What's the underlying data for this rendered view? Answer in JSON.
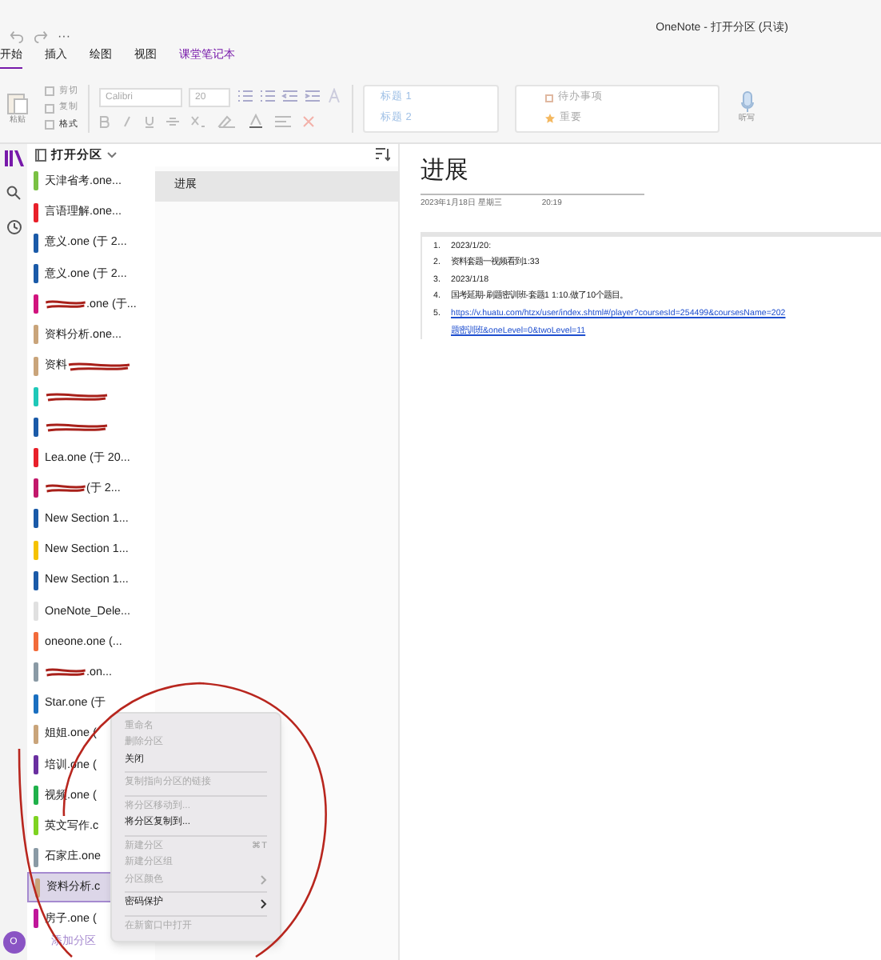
{
  "window": {
    "title": "OneNote - 打开分区 (只读)",
    "more": "···"
  },
  "ribbon": {
    "tabs": [
      {
        "label": "开始",
        "selected": true
      },
      {
        "label": "插入",
        "selected": false
      },
      {
        "label": "绘图",
        "selected": false
      },
      {
        "label": "视图",
        "selected": false
      },
      {
        "label": "课堂笔记本",
        "selected": false,
        "kind": "accent"
      }
    ],
    "paste": "粘贴",
    "clipboard": [
      "剪切",
      "复制",
      "格式"
    ],
    "font": "Calibri",
    "size": "20",
    "styles": [
      "标题 1",
      "标题 2"
    ],
    "tags": [
      "待办事项",
      "重要"
    ],
    "dictate": "听写"
  },
  "sidebar": {
    "header": "打开分区",
    "add_label": "添加分区",
    "avatar": "O"
  },
  "sections": [
    {
      "label": "天津省考.one...",
      "color": "#7ac143",
      "selected": false,
      "scribbled": false
    },
    {
      "label": "言语理解.one...",
      "color": "#e8202a",
      "selected": false,
      "scribbled": false
    },
    {
      "label": "意义.one (于 2...",
      "color": "#1a5aa8",
      "selected": false,
      "scribbled": false
    },
    {
      "label": "意义.one (于 2...",
      "color": "#1a5aa8",
      "selected": false,
      "scribbled": false
    },
    {
      "label": ".one (于...",
      "color": "#d1137e",
      "selected": false,
      "scribbled": true
    },
    {
      "label": "资料分析.one...",
      "color": "#c9a47a",
      "selected": false,
      "scribbled": false
    },
    {
      "label": "资料",
      "color": "#c9a47a",
      "selected": false,
      "scribbled": true
    },
    {
      "color": "#1ec8b8",
      "selected": false,
      "scribbled": true
    },
    {
      "color": "#1a5aa8",
      "selected": false,
      "scribbled": true
    },
    {
      "label": "Lea.one (于 20...",
      "color": "#e8202a",
      "selected": false,
      "scribbled": false
    },
    {
      "label": "(于 2...",
      "color": "#c2186b",
      "selected": false,
      "scribbled": true
    },
    {
      "label": "New Section 1...",
      "color": "#1a5aa8",
      "selected": false,
      "scribbled": false
    },
    {
      "label": "New Section 1...",
      "color": "#f5c200",
      "selected": false,
      "scribbled": false
    },
    {
      "label": "New Section 1...",
      "color": "#1a5aa8",
      "selected": false,
      "scribbled": false
    },
    {
      "label": "OneNote_Dele...",
      "color": "#e0e0e0",
      "selected": false,
      "scribbled": false
    },
    {
      "label": "oneone.one (...",
      "color": "#f26b3a",
      "selected": false,
      "scribbled": false
    },
    {
      "label": ".on...",
      "color": "#8a9aa5",
      "selected": false,
      "scribbled": true
    },
    {
      "label": "Star.one (于",
      "color": "#1a6fc0",
      "selected": false,
      "scribbled": false
    },
    {
      "label": "姐姐.one (",
      "color": "#c9a47a",
      "selected": false,
      "scribbled": false
    },
    {
      "label": "培训.one (",
      "color": "#6a2fa0",
      "selected": false,
      "scribbled": false
    },
    {
      "label": "视频.one (",
      "color": "#1fb14a",
      "selected": false,
      "scribbled": false
    },
    {
      "label": "英文写作.c",
      "color": "#7ed321",
      "selected": false,
      "scribbled": false
    },
    {
      "label": "石家庄.one",
      "color": "#8a9aa5",
      "selected": false,
      "scribbled": false
    },
    {
      "label": "资料分析.c",
      "color": "#c9a47a",
      "selected": true,
      "scribbled": false
    },
    {
      "label": "房子.one (",
      "color": "#c0169a",
      "selected": false,
      "scribbled": false
    }
  ],
  "pages": [
    {
      "label": "进展",
      "selected": true
    }
  ],
  "page": {
    "title": "进展",
    "date": "2023年1月18日 星期三",
    "time": "20:19",
    "items": [
      {
        "number": "1.",
        "text": "2023/1/20:",
        "kind": "text"
      },
      {
        "number": "2.",
        "text": "资料套题一视频看到1:33",
        "kind": "text"
      },
      {
        "number": "3.",
        "text": "2023/1/18",
        "kind": "text"
      },
      {
        "number": "4.",
        "text": "国考延期-刷题密训班-套题1 1:10.做了10个题目。",
        "kind": "text"
      },
      {
        "number": "5.",
        "text": "https://v.huatu.com/htzx/user/index.shtml#/player?coursesId=254499&coursesName=202",
        "text2": "题密训班&oneLevel=0&twoLevel=11",
        "kind": "link"
      }
    ]
  },
  "context_menu": {
    "items": [
      {
        "kind": "item",
        "label": "重命名",
        "disabled": true
      },
      {
        "kind": "item",
        "label": "删除分区",
        "disabled": true
      },
      {
        "kind": "item",
        "label": "关闭",
        "disabled": false
      },
      {
        "kind": "separator"
      },
      {
        "kind": "item",
        "label": "复制指向分区的链接",
        "disabled": true
      },
      {
        "kind": "separator"
      },
      {
        "kind": "item",
        "label": "将分区移动到...",
        "disabled": true
      },
      {
        "kind": "item",
        "label": "将分区复制到...",
        "disabled": false
      },
      {
        "kind": "separator"
      },
      {
        "kind": "item",
        "label": "新建分区",
        "shortcut": "⌘T",
        "disabled": true
      },
      {
        "kind": "item",
        "label": "新建分区组",
        "disabled": true
      },
      {
        "kind": "item",
        "label": "分区颜色",
        "submenu": true,
        "disabled": true
      },
      {
        "kind": "separator"
      },
      {
        "kind": "item",
        "label": "密码保护",
        "submenu": true,
        "disabled": false
      },
      {
        "kind": "separator"
      },
      {
        "kind": "item",
        "label": "在新窗口中打开",
        "disabled": true
      }
    ]
  }
}
